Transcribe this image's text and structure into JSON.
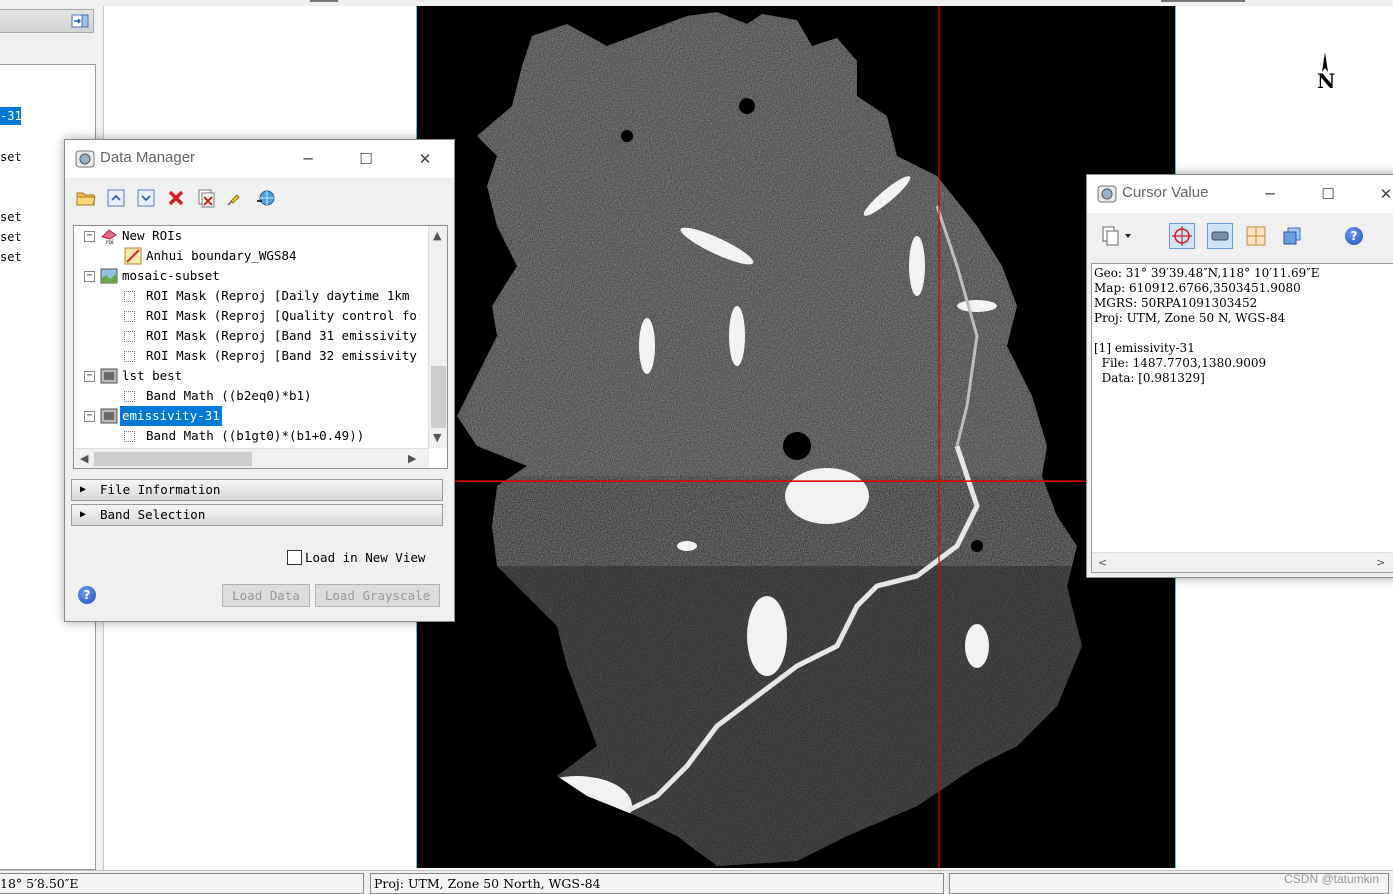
{
  "left_panel": {
    "items": [
      {
        "text": "-31",
        "selected": true
      },
      {
        "text": "set"
      },
      {
        "text": "set"
      },
      {
        "text": "set"
      },
      {
        "text": "set"
      }
    ]
  },
  "map": {
    "north_label": "N",
    "crosshair_color": "#e00000",
    "frame_color": "#4fc7d4"
  },
  "data_manager": {
    "title": "Data Manager",
    "window_buttons": {
      "minimize": "─",
      "maximize": "☐",
      "close": "✕"
    },
    "toolbar_icons": [
      "open-folder-icon",
      "collapse-up-icon",
      "expand-down-icon",
      "remove-icon",
      "close-all-icon",
      "pin-icon",
      "globe-link-icon"
    ],
    "tree": [
      {
        "label": "New ROIs",
        "level": 0,
        "expander": "−",
        "icon": "roi-icon"
      },
      {
        "label": "Anhui boundary_WGS84",
        "level": 1,
        "icon": "vector-layer-icon"
      },
      {
        "label": "mosaic-subset",
        "level": 0,
        "expander": "−",
        "icon": "raster-color-icon"
      },
      {
        "label": "ROI Mask (Reproj [Daily daytime 1km",
        "level": 1,
        "check": true
      },
      {
        "label": "ROI Mask (Reproj [Quality control fo:",
        "level": 1,
        "check": true
      },
      {
        "label": "ROI Mask (Reproj [Band 31 emissivity",
        "level": 1,
        "check": true
      },
      {
        "label": "ROI Mask (Reproj [Band 32 emissivity",
        "level": 1,
        "check": true
      },
      {
        "label": "lst best",
        "level": 0,
        "expander": "−",
        "icon": "raster-gray-icon"
      },
      {
        "label": "Band Math ((b2eq0)*b1)",
        "level": 1,
        "check": true
      },
      {
        "label": "emissivity-31",
        "level": 0,
        "expander": "−",
        "icon": "raster-gray-icon",
        "selected": true
      },
      {
        "label": "Band Math ((b1gt0)*(b1+0.49))",
        "level": 1,
        "check": true
      }
    ],
    "sections": [
      "File Information",
      "Band Selection"
    ],
    "load_in_new_view": "Load in New View",
    "buttons": {
      "load_data": "Load Data",
      "load_grayscale": "Load Grayscale"
    },
    "help": "?"
  },
  "cursor_value": {
    "title": "Cursor Value",
    "window_buttons": {
      "minimize": "─",
      "maximize": "☐",
      "close": "✕"
    },
    "toolbar_icons": [
      "copy-dropdown-icon",
      "crosshair-icon",
      "link-icon",
      "grid-icon",
      "layers-icon",
      "help-icon"
    ],
    "help": "?",
    "lines": [
      "Geo: 31° 39′39.48″N,118° 10′11.69″E",
      "Map: 610912.6766,3503451.9080",
      "MGRS: 50RPA1091303452",
      "Proj: UTM, Zone 50 N, WGS-84",
      "",
      "[1] emissivity-31",
      "  File: 1487.7703,1380.9009",
      "  Data: [0.981329]"
    ]
  },
  "status_bar": {
    "field1": "18° 5′8.50″E",
    "field2": "Proj: UTM, Zone 50 North, WGS-84",
    "field3": "",
    "watermark": "CSDN @tatumkin"
  }
}
